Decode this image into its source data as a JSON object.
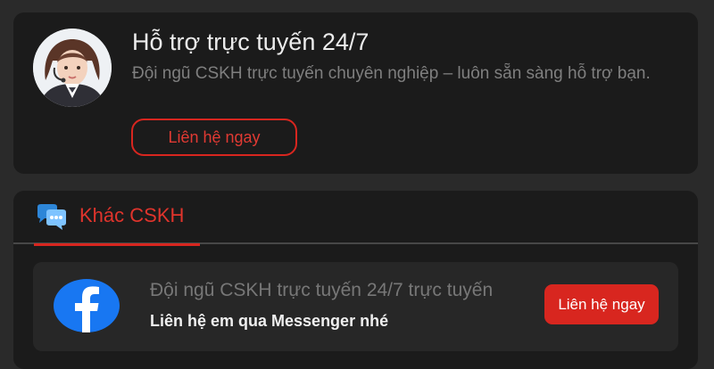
{
  "support": {
    "title": "Hỗ trợ trực tuyến 24/7",
    "description": "Đội ngũ CSKH trực tuyến chuyên nghiệp – luôn sẵn sàng hỗ trợ bạn.",
    "button_label": "Liên hệ ngay"
  },
  "other": {
    "tab_label": "Khác CSKH",
    "items": [
      {
        "icon": "facebook-icon",
        "title": "Đội ngũ CSKH trực tuyến 24/7 trực tuyến",
        "subtitle": "Liên hệ em qua Messenger nhé",
        "button_label": "Liên hệ ngay"
      }
    ]
  },
  "colors": {
    "accent": "#d8261f",
    "card_bg": "#1b1b1b",
    "page_bg": "#2a2a2a",
    "facebook_blue": "#1877f2"
  }
}
